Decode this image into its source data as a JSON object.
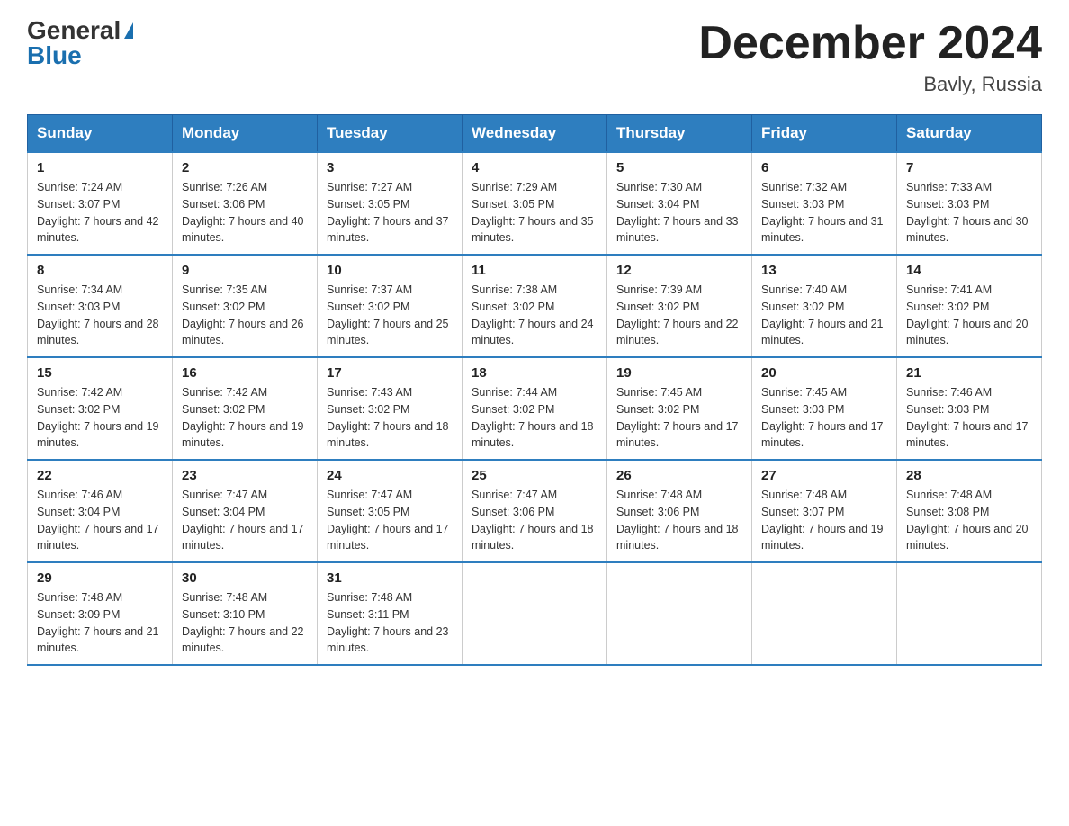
{
  "logo": {
    "general": "General",
    "blue": "Blue"
  },
  "title": "December 2024",
  "subtitle": "Bavly, Russia",
  "days_of_week": [
    "Sunday",
    "Monday",
    "Tuesday",
    "Wednesday",
    "Thursday",
    "Friday",
    "Saturday"
  ],
  "weeks": [
    [
      {
        "day": "1",
        "sunrise": "7:24 AM",
        "sunset": "3:07 PM",
        "daylight": "7 hours and 42 minutes."
      },
      {
        "day": "2",
        "sunrise": "7:26 AM",
        "sunset": "3:06 PM",
        "daylight": "7 hours and 40 minutes."
      },
      {
        "day": "3",
        "sunrise": "7:27 AM",
        "sunset": "3:05 PM",
        "daylight": "7 hours and 37 minutes."
      },
      {
        "day": "4",
        "sunrise": "7:29 AM",
        "sunset": "3:05 PM",
        "daylight": "7 hours and 35 minutes."
      },
      {
        "day": "5",
        "sunrise": "7:30 AM",
        "sunset": "3:04 PM",
        "daylight": "7 hours and 33 minutes."
      },
      {
        "day": "6",
        "sunrise": "7:32 AM",
        "sunset": "3:03 PM",
        "daylight": "7 hours and 31 minutes."
      },
      {
        "day": "7",
        "sunrise": "7:33 AM",
        "sunset": "3:03 PM",
        "daylight": "7 hours and 30 minutes."
      }
    ],
    [
      {
        "day": "8",
        "sunrise": "7:34 AM",
        "sunset": "3:03 PM",
        "daylight": "7 hours and 28 minutes."
      },
      {
        "day": "9",
        "sunrise": "7:35 AM",
        "sunset": "3:02 PM",
        "daylight": "7 hours and 26 minutes."
      },
      {
        "day": "10",
        "sunrise": "7:37 AM",
        "sunset": "3:02 PM",
        "daylight": "7 hours and 25 minutes."
      },
      {
        "day": "11",
        "sunrise": "7:38 AM",
        "sunset": "3:02 PM",
        "daylight": "7 hours and 24 minutes."
      },
      {
        "day": "12",
        "sunrise": "7:39 AM",
        "sunset": "3:02 PM",
        "daylight": "7 hours and 22 minutes."
      },
      {
        "day": "13",
        "sunrise": "7:40 AM",
        "sunset": "3:02 PM",
        "daylight": "7 hours and 21 minutes."
      },
      {
        "day": "14",
        "sunrise": "7:41 AM",
        "sunset": "3:02 PM",
        "daylight": "7 hours and 20 minutes."
      }
    ],
    [
      {
        "day": "15",
        "sunrise": "7:42 AM",
        "sunset": "3:02 PM",
        "daylight": "7 hours and 19 minutes."
      },
      {
        "day": "16",
        "sunrise": "7:42 AM",
        "sunset": "3:02 PM",
        "daylight": "7 hours and 19 minutes."
      },
      {
        "day": "17",
        "sunrise": "7:43 AM",
        "sunset": "3:02 PM",
        "daylight": "7 hours and 18 minutes."
      },
      {
        "day": "18",
        "sunrise": "7:44 AM",
        "sunset": "3:02 PM",
        "daylight": "7 hours and 18 minutes."
      },
      {
        "day": "19",
        "sunrise": "7:45 AM",
        "sunset": "3:02 PM",
        "daylight": "7 hours and 17 minutes."
      },
      {
        "day": "20",
        "sunrise": "7:45 AM",
        "sunset": "3:03 PM",
        "daylight": "7 hours and 17 minutes."
      },
      {
        "day": "21",
        "sunrise": "7:46 AM",
        "sunset": "3:03 PM",
        "daylight": "7 hours and 17 minutes."
      }
    ],
    [
      {
        "day": "22",
        "sunrise": "7:46 AM",
        "sunset": "3:04 PM",
        "daylight": "7 hours and 17 minutes."
      },
      {
        "day": "23",
        "sunrise": "7:47 AM",
        "sunset": "3:04 PM",
        "daylight": "7 hours and 17 minutes."
      },
      {
        "day": "24",
        "sunrise": "7:47 AM",
        "sunset": "3:05 PM",
        "daylight": "7 hours and 17 minutes."
      },
      {
        "day": "25",
        "sunrise": "7:47 AM",
        "sunset": "3:06 PM",
        "daylight": "7 hours and 18 minutes."
      },
      {
        "day": "26",
        "sunrise": "7:48 AM",
        "sunset": "3:06 PM",
        "daylight": "7 hours and 18 minutes."
      },
      {
        "day": "27",
        "sunrise": "7:48 AM",
        "sunset": "3:07 PM",
        "daylight": "7 hours and 19 minutes."
      },
      {
        "day": "28",
        "sunrise": "7:48 AM",
        "sunset": "3:08 PM",
        "daylight": "7 hours and 20 minutes."
      }
    ],
    [
      {
        "day": "29",
        "sunrise": "7:48 AM",
        "sunset": "3:09 PM",
        "daylight": "7 hours and 21 minutes."
      },
      {
        "day": "30",
        "sunrise": "7:48 AM",
        "sunset": "3:10 PM",
        "daylight": "7 hours and 22 minutes."
      },
      {
        "day": "31",
        "sunrise": "7:48 AM",
        "sunset": "3:11 PM",
        "daylight": "7 hours and 23 minutes."
      },
      null,
      null,
      null,
      null
    ]
  ]
}
